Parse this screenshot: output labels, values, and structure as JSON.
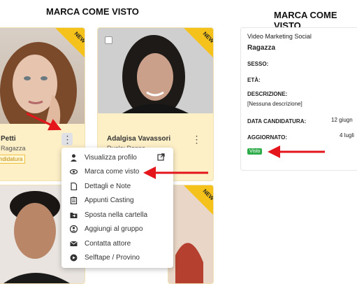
{
  "headings": {
    "left": "MARCA COME VISTO",
    "right": "MARCA COME VISTO"
  },
  "cards": [
    {
      "name": "Petti",
      "role": "Ragazza",
      "badge": "ndidatura",
      "new": "NEW"
    },
    {
      "name": "Adalgisa Vavassori",
      "role": "Ruolo: Donna",
      "new": "NEW"
    },
    {
      "new": "NEW"
    }
  ],
  "menu": {
    "items": [
      {
        "label": "Visualizza profilo",
        "icon": "person-icon"
      },
      {
        "label": "Marca come visto",
        "icon": "eye-icon"
      },
      {
        "label": "Dettagli e Note",
        "icon": "document-icon"
      },
      {
        "label": "Appunti Casting",
        "icon": "clipboard-icon"
      },
      {
        "label": "Sposta nella cartella",
        "icon": "folder-move-icon"
      },
      {
        "label": "Aggiungi al gruppo",
        "icon": "group-icon"
      },
      {
        "label": "Contatta attore",
        "icon": "envelope-icon"
      },
      {
        "label": "Selftape / Provino",
        "icon": "video-camera-icon"
      }
    ]
  },
  "detail": {
    "project": "Video Marketing Social",
    "role": "Ragazza",
    "sesso_label": "SESSO:",
    "eta_label": "ETÀ:",
    "descrizione_label": "DESCRIZIONE:",
    "descrizione_value": "[Nessuna descrizione]",
    "data_label": "DATA CANDIDATURA:",
    "data_value": "12 giugn",
    "agg_label": "AGGIORNATO:",
    "agg_value": "4 lugli",
    "badge": "Visto",
    "badge_color": "#2eac4a"
  },
  "colors": {
    "card_bg": "#fdefc6",
    "ribbon": "#f5c21b",
    "arrow": "#e4161b"
  }
}
